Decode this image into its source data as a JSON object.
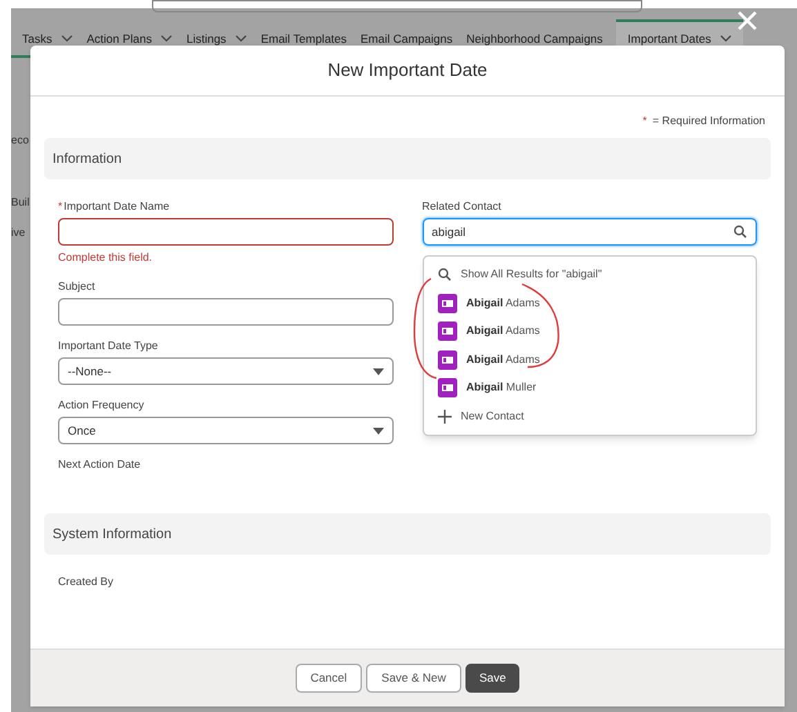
{
  "background": {
    "nav_tabs": [
      {
        "label": "Tasks",
        "dropdown": true,
        "selected": false
      },
      {
        "label": "Action Plans",
        "dropdown": true,
        "selected": false
      },
      {
        "label": "Listings",
        "dropdown": true,
        "selected": false
      },
      {
        "label": "Email Templates",
        "dropdown": false,
        "selected": false
      },
      {
        "label": "Email Campaigns",
        "dropdown": false,
        "selected": false
      },
      {
        "label": "Neighborhood Campaigns",
        "dropdown": false,
        "selected": false
      },
      {
        "label": "Important Dates",
        "dropdown": true,
        "selected": true
      }
    ],
    "fragments": [
      "eco",
      "Buil",
      "ive"
    ]
  },
  "modal": {
    "title": "New Important Date",
    "required_marker": "*",
    "required_note": "= Required Information",
    "sections": [
      {
        "title": "Information",
        "left_fields": [
          {
            "kind": "text",
            "marker": "*",
            "label": "Important Date Name",
            "error": "Complete this field."
          },
          {
            "kind": "text",
            "label": "Subject"
          },
          {
            "kind": "select",
            "label": "Important Date Type",
            "value": "--None--"
          },
          {
            "kind": "select",
            "label": "Action Frequency",
            "value": "Once"
          },
          {
            "kind": "static",
            "label": "Next Action Date"
          }
        ],
        "right_fields": [
          {
            "kind": "lookup",
            "label": "Related Contact",
            "value": "abigail",
            "focused": true
          }
        ]
      },
      {
        "title": "System Information",
        "left_fields": [
          {
            "kind": "static",
            "label": "Created By"
          }
        ]
      }
    ],
    "lookup_dropdown": [
      {
        "kind": "search",
        "text": "Show All Results for \"abigail\""
      },
      {
        "kind": "contact",
        "text": "**Abigail** Adams"
      },
      {
        "kind": "contact",
        "text": "**Abigail** Adams"
      },
      {
        "kind": "contact",
        "text": "**Abigail** Adams"
      },
      {
        "kind": "contact",
        "text": "**Abigail** Muller"
      },
      {
        "kind": "new",
        "text": "New Contact"
      }
    ],
    "buttons": [
      {
        "label": "Cancel",
        "primary": false
      },
      {
        "label": "Save & New",
        "primary": false
      },
      {
        "label": "Save",
        "primary": true
      }
    ]
  }
}
